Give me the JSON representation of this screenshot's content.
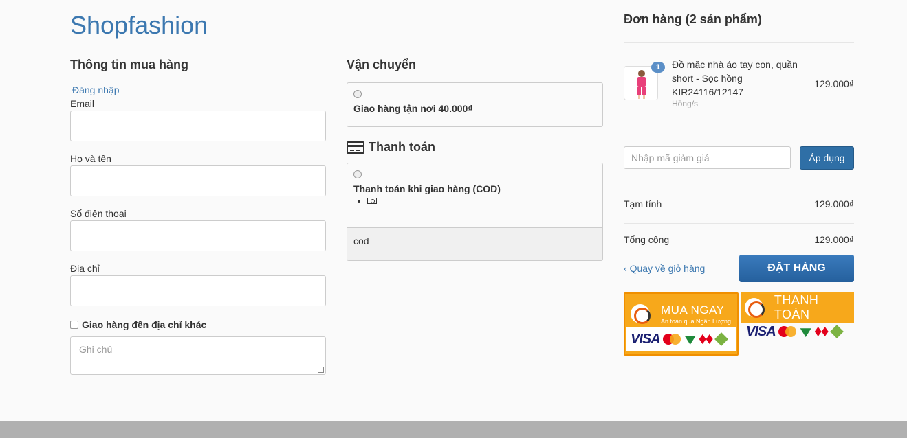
{
  "shop": {
    "name": "Shopfashion"
  },
  "buyer": {
    "title": "Thông tin mua hàng",
    "login_link": "Đăng nhập",
    "fields": [
      {
        "label": "Email",
        "value": ""
      },
      {
        "label": "Họ và tên",
        "value": ""
      },
      {
        "label": "Số điện thoại",
        "value": ""
      },
      {
        "label": "Địa chỉ",
        "value": ""
      }
    ],
    "ship_other_label": "Giao hàng đến địa chỉ khác",
    "ship_other_checked": false,
    "note_placeholder": "Ghi chú"
  },
  "shipping": {
    "title": "Vận chuyển",
    "option_label": "Giao hàng tận nơi 40.000₫",
    "selected": false
  },
  "payment": {
    "title": "Thanh toán",
    "option_label": "Thanh toán khi giao hàng (COD)",
    "selected": false,
    "detail_text": "cod"
  },
  "order": {
    "title": "Đơn hàng (2 sản phẩm)",
    "items": [
      {
        "quantity": "1",
        "name": "Đồ mặc nhà áo tay con, quần short - Sọc hồng KIR24116/12147",
        "variant": "Hồng/s",
        "price": "129.000₫"
      }
    ],
    "discount_placeholder": "Nhập mã giảm giá",
    "apply_label": "Áp dụng",
    "subtotal_label": "Tạm tính",
    "subtotal_value": "129.000₫",
    "total_label": "Tổng cộng",
    "total_value": "129.000₫",
    "back_label": "Quay về giỏ hàng",
    "place_order_label": "ĐẶT HÀNG"
  },
  "badges": {
    "buy_now": {
      "title": "MUA NGAY",
      "subtitle": "An toàn qua Ngân Lượng",
      "card": "VISA",
      "mastercard": "MasterCard"
    },
    "pay": {
      "title": "THANH TOÁN",
      "card": "VISA",
      "mastercard": "MasterCard"
    }
  },
  "colors": {
    "brand": "#3c78b0",
    "primary_button": "#2f6fa6",
    "badge_orange": "#f7a81b"
  }
}
